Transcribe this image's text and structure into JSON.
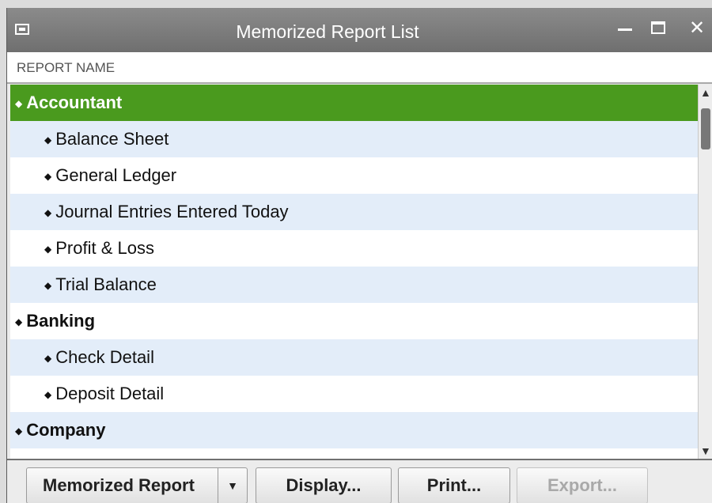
{
  "window": {
    "title": "Memorized Report List"
  },
  "list": {
    "column_header": "REPORT NAME",
    "rows": [
      {
        "label": "Accountant",
        "level": "group",
        "selected": true
      },
      {
        "label": "Balance Sheet",
        "level": "item"
      },
      {
        "label": "General Ledger",
        "level": "item"
      },
      {
        "label": "Journal Entries Entered Today",
        "level": "item"
      },
      {
        "label": "Profit & Loss",
        "level": "item"
      },
      {
        "label": "Trial Balance",
        "level": "item"
      },
      {
        "label": "Banking",
        "level": "group"
      },
      {
        "label": "Check Detail",
        "level": "item"
      },
      {
        "label": "Deposit Detail",
        "level": "item"
      },
      {
        "label": "Company",
        "level": "group"
      }
    ],
    "bullet_icon": "diamond-bullet-icon"
  },
  "buttons": {
    "memorized_report": "Memorized Report",
    "display": "Display...",
    "print": "Print...",
    "export": "Export..."
  },
  "colors": {
    "selected_row": "#4a9a1e",
    "alt_row": "#e3edf9",
    "titlebar": "#7d7d7d"
  }
}
